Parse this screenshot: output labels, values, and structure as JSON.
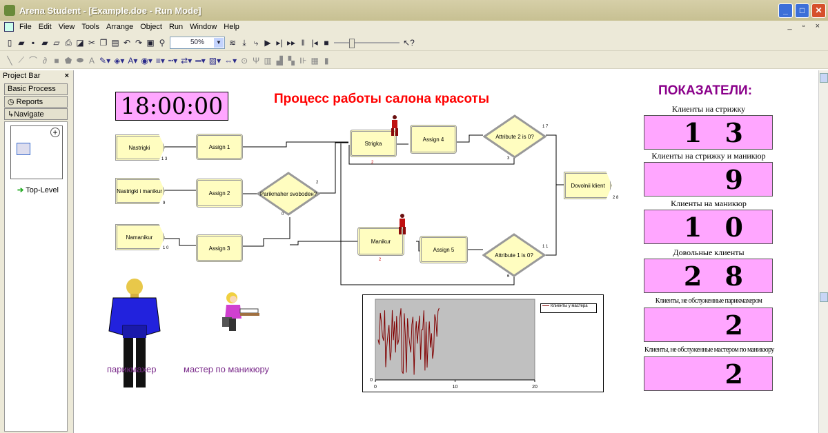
{
  "window": {
    "title": "Arena Student - [Example.doe - Run Mode]"
  },
  "menu": [
    "File",
    "Edit",
    "View",
    "Tools",
    "Arrange",
    "Object",
    "Run",
    "Window",
    "Help"
  ],
  "toolbar": {
    "zoom": "50%"
  },
  "project_bar": {
    "title": "Project Bar",
    "tabs": [
      "Basic Process",
      "Reports",
      "Navigate"
    ],
    "tree_item": "Top-Level"
  },
  "canvas": {
    "clock": "18:00:00",
    "title": "Процесс работы салона красоты",
    "modules": {
      "create1": "Nastrigki",
      "create2": "Nastrigki i manikur",
      "create3": "Namanikur",
      "assign1": "Assign 1",
      "assign2": "Assign 2",
      "assign3": "Assign 3",
      "decide1": "Parikmaher svobodeн?",
      "process1": "Strigka",
      "process2": "Manikur",
      "assign4": "Assign 4",
      "assign5": "Assign 5",
      "decide2": "Attribute 2 is 0?",
      "decide3": "Attribute 1 is 0?",
      "dispose": "Dovolnii klient"
    },
    "counts": {
      "create1": "1 3",
      "create2": "9",
      "create3": "1 0",
      "decide1_top": "2",
      "decide1_bottom": "0",
      "process1": "2",
      "process2": "2",
      "decide2_right": "1 7",
      "decide2_bottom": "3",
      "decide3_right": "1 1",
      "decide3_bottom": "6",
      "dispose": "2 8"
    },
    "workers": {
      "hairdresser": "парикмахер",
      "manicurist": "мастер по маникюру"
    }
  },
  "indicators": {
    "title": "ПОКАЗАТЕЛИ:",
    "items": [
      {
        "label": "Клиенты на стрижку",
        "value": "1 3"
      },
      {
        "label": "Клиенты на стрижку и маникюр",
        "value": "9"
      },
      {
        "label": "Клиенты на маникюр",
        "value": "1 0"
      },
      {
        "label": "Довольные клиенты",
        "value": "2 8"
      },
      {
        "label": "Клиенты, не обслуженные парикмахером",
        "value": "2"
      },
      {
        "label": "Клиенты, не обслуженные мастером по маникюру",
        "value": "2"
      }
    ]
  },
  "chart_data": {
    "type": "line",
    "title": "",
    "xlabel": "",
    "ylabel": "",
    "xlim": [
      0,
      20
    ],
    "x_ticks": [
      "0",
      "10",
      "20"
    ],
    "y_ticks": [
      "0"
    ],
    "series": [
      {
        "name": "Клиенты у мастера",
        "color": "#800000"
      }
    ]
  }
}
